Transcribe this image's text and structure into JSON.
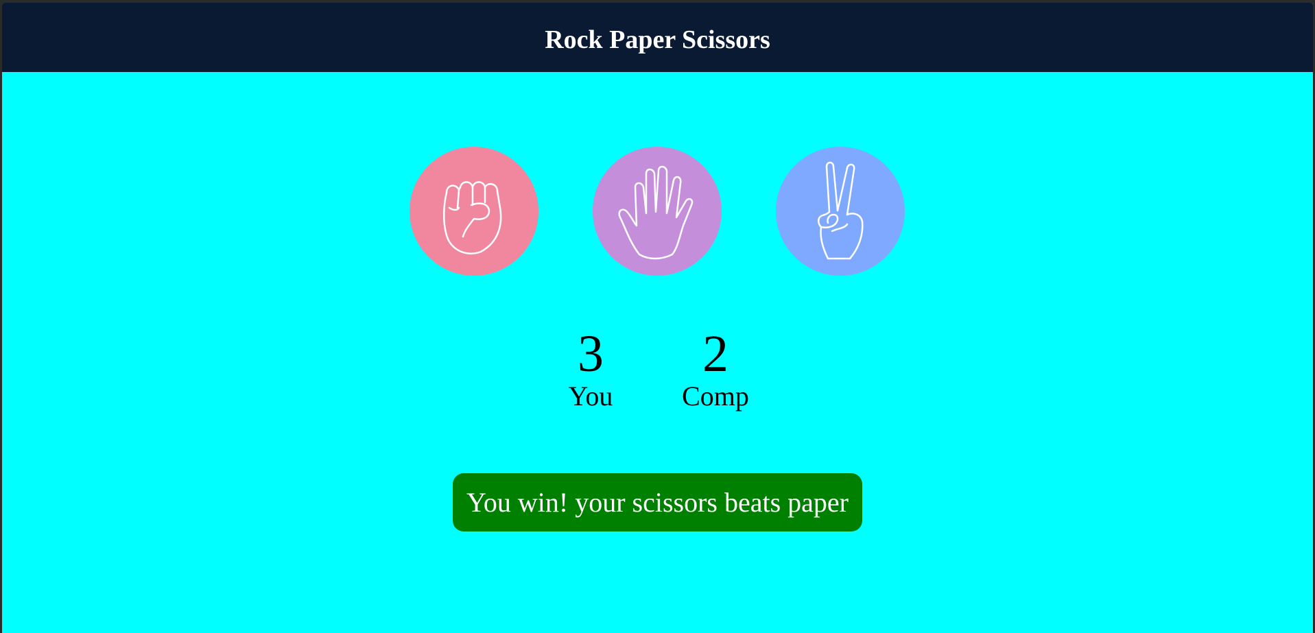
{
  "app": {
    "title": "Rock Paper Scissors"
  },
  "choices": [
    {
      "id": "rock",
      "icon": "fist-icon",
      "color": "#f0879f"
    },
    {
      "id": "paper",
      "icon": "open-hand-icon",
      "color": "#c58edb"
    },
    {
      "id": "scissors",
      "icon": "peace-hand-icon",
      "color": "#7fa9ff"
    }
  ],
  "score": {
    "user": {
      "value": "3",
      "label": "You"
    },
    "comp": {
      "value": "2",
      "label": "Comp"
    }
  },
  "result": {
    "text": "You win! your scissors beats paper",
    "color": "#008000"
  },
  "colors": {
    "background": "#00ffff",
    "header": "#0a1a33"
  }
}
